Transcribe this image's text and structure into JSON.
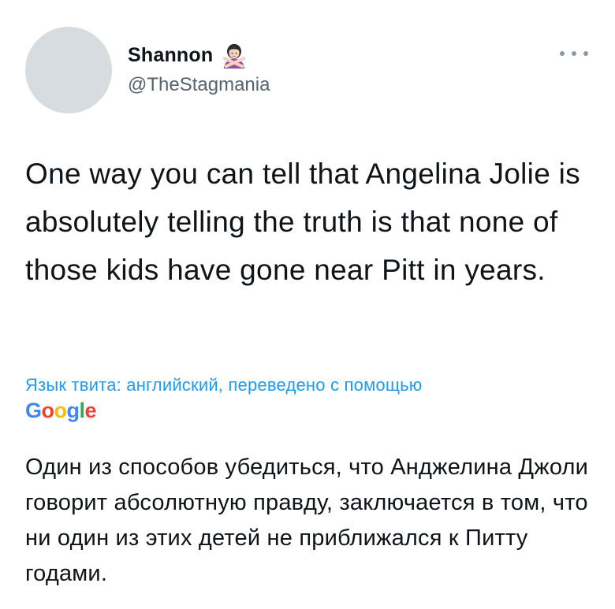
{
  "author": {
    "display_name": "Shannon",
    "handle": "@TheStagmania",
    "name_emoji": "person-gesturing-no-emoji"
  },
  "menu": {
    "icon": "more-horizontal-icon"
  },
  "tweet": {
    "text": "One way you can tell that Angelina Jolie is absolutely telling the truth is that none of those kids have gone near Pitt in years."
  },
  "translation": {
    "meta": "Язык твита: английский, переведено с помощью",
    "provider_logo": "Google",
    "text": "Один из способов убедиться, что Анджелина Джоли говорит абсолютную правду, заключается в том, что ни один из этих детей не приближался к Питту годами."
  },
  "colors": {
    "text": "#0f1419",
    "secondary": "#536471",
    "link": "#1d9bf0",
    "avatar": "#d7dce0"
  }
}
